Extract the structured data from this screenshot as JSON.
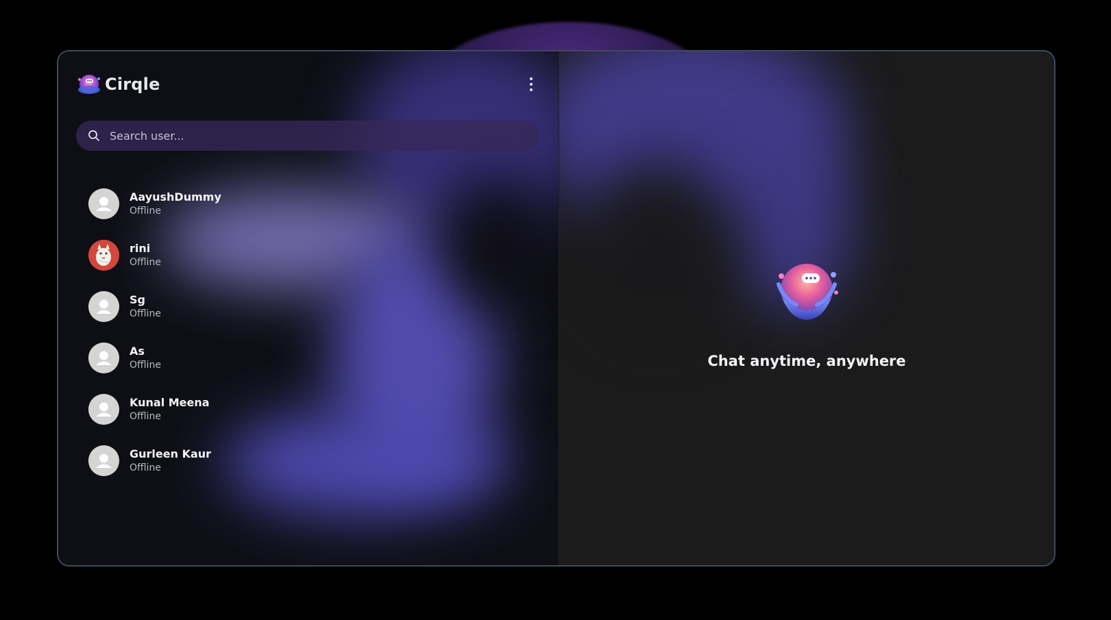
{
  "app": {
    "name": "Cirqle",
    "logo_icon": "cirqle-logo-icon"
  },
  "header": {
    "menu_icon": "more-vertical-icon"
  },
  "search": {
    "placeholder": "Search user...",
    "value": "",
    "icon": "search-icon"
  },
  "users": [
    {
      "name": "AayushDummy",
      "status": "Offline",
      "avatar": "default-avatar-icon"
    },
    {
      "name": "rini",
      "status": "Offline",
      "avatar": "cat-avatar-image"
    },
    {
      "name": "Sg",
      "status": "Offline",
      "avatar": "default-avatar-icon"
    },
    {
      "name": "As",
      "status": "Offline",
      "avatar": "default-avatar-icon"
    },
    {
      "name": "Kunal Meena",
      "status": "Offline",
      "avatar": "default-avatar-icon"
    },
    {
      "name": "Gurleen Kaur",
      "status": "Offline",
      "avatar": "default-avatar-icon"
    }
  ],
  "welcome": {
    "tagline": "Chat anytime, anywhere",
    "illustration": "chat-globe-illustration"
  },
  "colors": {
    "background": "#000000",
    "sidebar": "#0e0f15",
    "chat_panel": "#1b1b1c",
    "accent": "#5a4ec0",
    "search_bar": "#362858"
  }
}
